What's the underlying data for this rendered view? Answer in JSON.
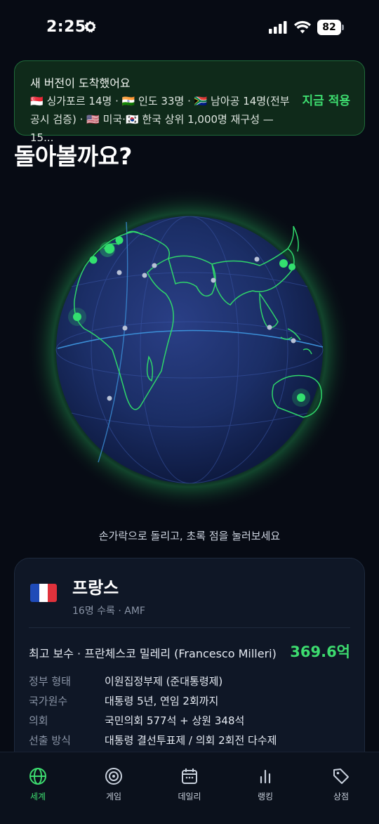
{
  "status_bar": {
    "time": "2:25",
    "battery": "82"
  },
  "update_banner": {
    "title": "새 버전이 도착했어요",
    "body": "🇸🇬 싱가포르 14명 · 🇮🇳 인도 33명 · 🇿🇦 남아공 14명(전부 공시 검증) · 🇺🇸 미국·🇰🇷 한국 상위 1,000명 재구성 — 15...",
    "action": "지금 적용"
  },
  "heading": "돌아볼까요?",
  "globe": {
    "hint": "손가락으로 돌리고, 초록 점을 눌러보세요",
    "ocean_color": "#1b2e66",
    "land_outline_color": "#2fd66a",
    "glow_color": "#2fd66a"
  },
  "country_card": {
    "flag": "flag-france",
    "name": "프랑스",
    "subtitle": "16명 수록 · AMF",
    "top_pay_label": "최고 보수 · 프란체스코 밀레리 (Francesco Milleri)",
    "top_pay_value": "369.6억",
    "rows": [
      {
        "key": "정부 형태",
        "value": "이원집정부제 (준대통령제)"
      },
      {
        "key": "국가원수",
        "value": "대통령 5년, 연임 2회까지"
      },
      {
        "key": "의회",
        "value": "국민의회 577석 + 상원 348석"
      },
      {
        "key": "선출 방식",
        "value": "대통령 결선투표제 / 의회 2회전 다수제"
      }
    ]
  },
  "tab_bar": {
    "tabs": [
      {
        "label": "세계",
        "icon": "globe-icon",
        "active": true
      },
      {
        "label": "게임",
        "icon": "target-icon",
        "active": false
      },
      {
        "label": "데일리",
        "icon": "calendar-icon",
        "active": false
      },
      {
        "label": "랭킹",
        "icon": "bar-chart-icon",
        "active": false
      },
      {
        "label": "상점",
        "icon": "tag-icon",
        "active": false
      }
    ]
  },
  "colors": {
    "accent": "#3ddc6f",
    "background": "#070b14",
    "card": "#0f1726"
  }
}
